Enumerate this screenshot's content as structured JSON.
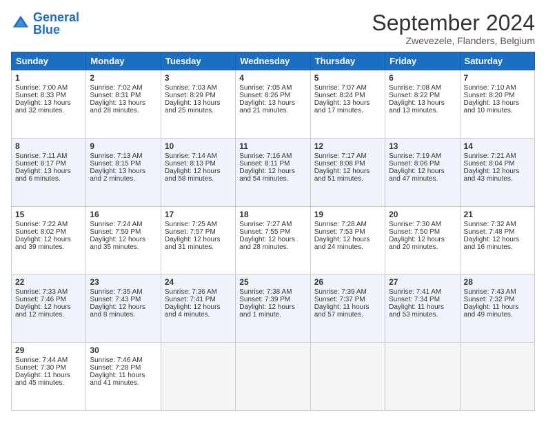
{
  "logo": {
    "line1": "General",
    "line2": "Blue"
  },
  "title": "September 2024",
  "subtitle": "Zwevezele, Flanders, Belgium",
  "headers": [
    "Sunday",
    "Monday",
    "Tuesday",
    "Wednesday",
    "Thursday",
    "Friday",
    "Saturday"
  ],
  "weeks": [
    [
      {
        "day": "1",
        "rise": "Sunrise: 7:00 AM",
        "set": "Sunset: 8:33 PM",
        "day1": "Daylight: 13 hours",
        "day2": "and 32 minutes."
      },
      {
        "day": "2",
        "rise": "Sunrise: 7:02 AM",
        "set": "Sunset: 8:31 PM",
        "day1": "Daylight: 13 hours",
        "day2": "and 28 minutes."
      },
      {
        "day": "3",
        "rise": "Sunrise: 7:03 AM",
        "set": "Sunset: 8:29 PM",
        "day1": "Daylight: 13 hours",
        "day2": "and 25 minutes."
      },
      {
        "day": "4",
        "rise": "Sunrise: 7:05 AM",
        "set": "Sunset: 8:26 PM",
        "day1": "Daylight: 13 hours",
        "day2": "and 21 minutes."
      },
      {
        "day": "5",
        "rise": "Sunrise: 7:07 AM",
        "set": "Sunset: 8:24 PM",
        "day1": "Daylight: 13 hours",
        "day2": "and 17 minutes."
      },
      {
        "day": "6",
        "rise": "Sunrise: 7:08 AM",
        "set": "Sunset: 8:22 PM",
        "day1": "Daylight: 13 hours",
        "day2": "and 13 minutes."
      },
      {
        "day": "7",
        "rise": "Sunrise: 7:10 AM",
        "set": "Sunset: 8:20 PM",
        "day1": "Daylight: 13 hours",
        "day2": "and 10 minutes."
      }
    ],
    [
      {
        "day": "8",
        "rise": "Sunrise: 7:11 AM",
        "set": "Sunset: 8:17 PM",
        "day1": "Daylight: 13 hours",
        "day2": "and 6 minutes."
      },
      {
        "day": "9",
        "rise": "Sunrise: 7:13 AM",
        "set": "Sunset: 8:15 PM",
        "day1": "Daylight: 13 hours",
        "day2": "and 2 minutes."
      },
      {
        "day": "10",
        "rise": "Sunrise: 7:14 AM",
        "set": "Sunset: 8:13 PM",
        "day1": "Daylight: 12 hours",
        "day2": "and 58 minutes."
      },
      {
        "day": "11",
        "rise": "Sunrise: 7:16 AM",
        "set": "Sunset: 8:11 PM",
        "day1": "Daylight: 12 hours",
        "day2": "and 54 minutes."
      },
      {
        "day": "12",
        "rise": "Sunrise: 7:17 AM",
        "set": "Sunset: 8:08 PM",
        "day1": "Daylight: 12 hours",
        "day2": "and 51 minutes."
      },
      {
        "day": "13",
        "rise": "Sunrise: 7:19 AM",
        "set": "Sunset: 8:06 PM",
        "day1": "Daylight: 12 hours",
        "day2": "and 47 minutes."
      },
      {
        "day": "14",
        "rise": "Sunrise: 7:21 AM",
        "set": "Sunset: 8:04 PM",
        "day1": "Daylight: 12 hours",
        "day2": "and 43 minutes."
      }
    ],
    [
      {
        "day": "15",
        "rise": "Sunrise: 7:22 AM",
        "set": "Sunset: 8:02 PM",
        "day1": "Daylight: 12 hours",
        "day2": "and 39 minutes."
      },
      {
        "day": "16",
        "rise": "Sunrise: 7:24 AM",
        "set": "Sunset: 7:59 PM",
        "day1": "Daylight: 12 hours",
        "day2": "and 35 minutes."
      },
      {
        "day": "17",
        "rise": "Sunrise: 7:25 AM",
        "set": "Sunset: 7:57 PM",
        "day1": "Daylight: 12 hours",
        "day2": "and 31 minutes."
      },
      {
        "day": "18",
        "rise": "Sunrise: 7:27 AM",
        "set": "Sunset: 7:55 PM",
        "day1": "Daylight: 12 hours",
        "day2": "and 28 minutes."
      },
      {
        "day": "19",
        "rise": "Sunrise: 7:28 AM",
        "set": "Sunset: 7:53 PM",
        "day1": "Daylight: 12 hours",
        "day2": "and 24 minutes."
      },
      {
        "day": "20",
        "rise": "Sunrise: 7:30 AM",
        "set": "Sunset: 7:50 PM",
        "day1": "Daylight: 12 hours",
        "day2": "and 20 minutes."
      },
      {
        "day": "21",
        "rise": "Sunrise: 7:32 AM",
        "set": "Sunset: 7:48 PM",
        "day1": "Daylight: 12 hours",
        "day2": "and 16 minutes."
      }
    ],
    [
      {
        "day": "22",
        "rise": "Sunrise: 7:33 AM",
        "set": "Sunset: 7:46 PM",
        "day1": "Daylight: 12 hours",
        "day2": "and 12 minutes."
      },
      {
        "day": "23",
        "rise": "Sunrise: 7:35 AM",
        "set": "Sunset: 7:43 PM",
        "day1": "Daylight: 12 hours",
        "day2": "and 8 minutes."
      },
      {
        "day": "24",
        "rise": "Sunrise: 7:36 AM",
        "set": "Sunset: 7:41 PM",
        "day1": "Daylight: 12 hours",
        "day2": "and 4 minutes."
      },
      {
        "day": "25",
        "rise": "Sunrise: 7:38 AM",
        "set": "Sunset: 7:39 PM",
        "day1": "Daylight: 12 hours",
        "day2": "and 1 minute."
      },
      {
        "day": "26",
        "rise": "Sunrise: 7:39 AM",
        "set": "Sunset: 7:37 PM",
        "day1": "Daylight: 11 hours",
        "day2": "and 57 minutes."
      },
      {
        "day": "27",
        "rise": "Sunrise: 7:41 AM",
        "set": "Sunset: 7:34 PM",
        "day1": "Daylight: 11 hours",
        "day2": "and 53 minutes."
      },
      {
        "day": "28",
        "rise": "Sunrise: 7:43 AM",
        "set": "Sunset: 7:32 PM",
        "day1": "Daylight: 11 hours",
        "day2": "and 49 minutes."
      }
    ],
    [
      {
        "day": "29",
        "rise": "Sunrise: 7:44 AM",
        "set": "Sunset: 7:30 PM",
        "day1": "Daylight: 11 hours",
        "day2": "and 45 minutes."
      },
      {
        "day": "30",
        "rise": "Sunrise: 7:46 AM",
        "set": "Sunset: 7:28 PM",
        "day1": "Daylight: 11 hours",
        "day2": "and 41 minutes."
      },
      null,
      null,
      null,
      null,
      null
    ]
  ]
}
